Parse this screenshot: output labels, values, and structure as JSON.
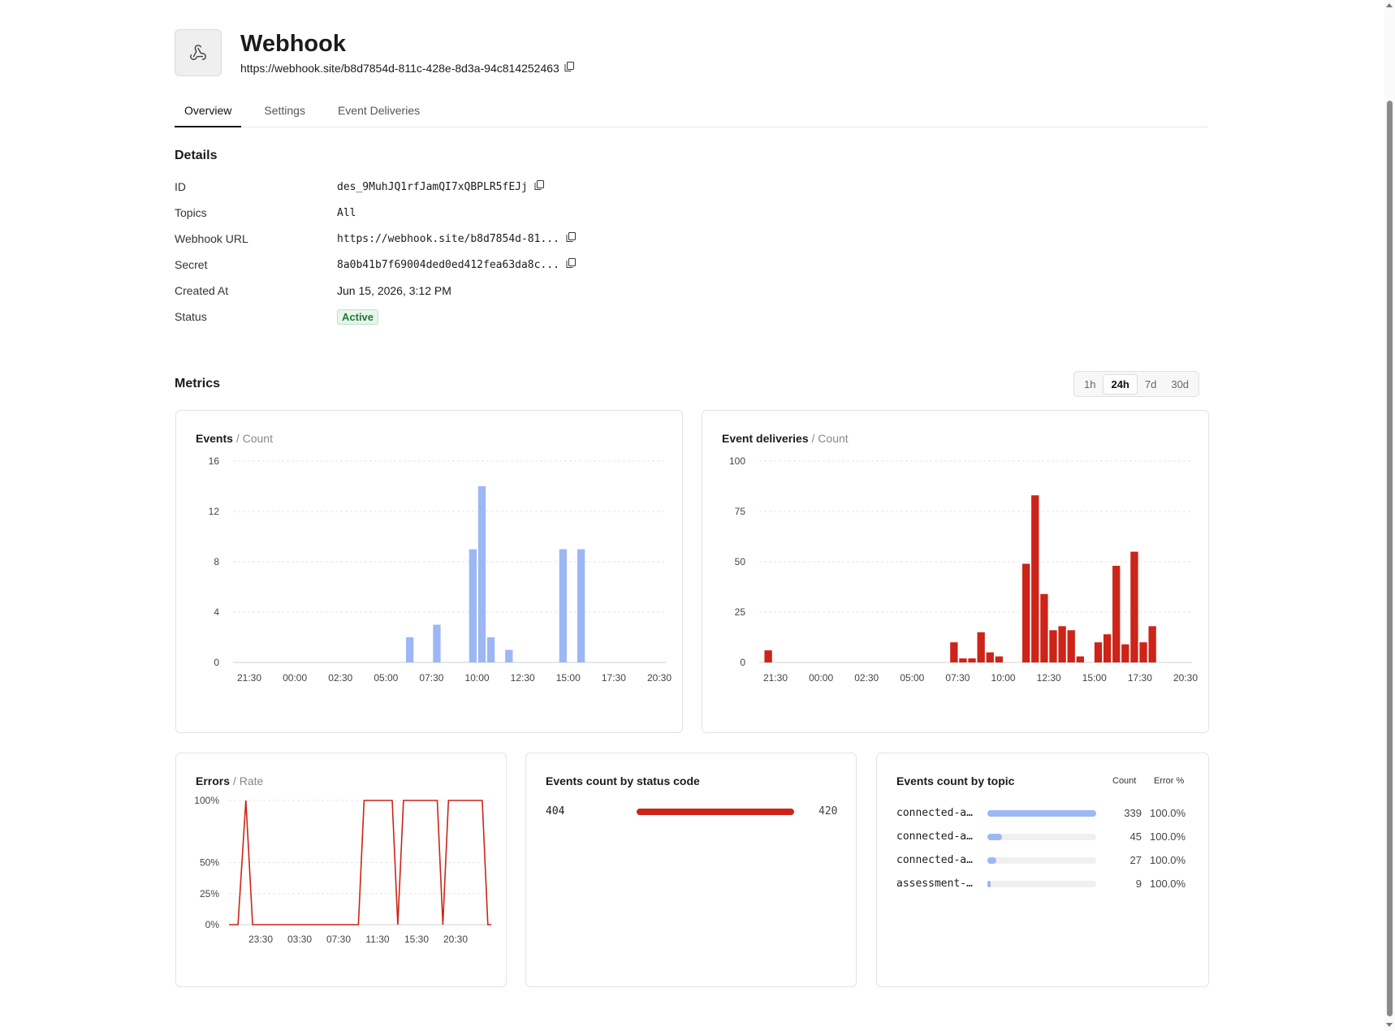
{
  "header": {
    "title": "Webhook",
    "url": "https://webhook.site/b8d7854d-811c-428e-8d3a-94c814252463"
  },
  "tabs": [
    "Overview",
    "Settings",
    "Event Deliveries"
  ],
  "details": {
    "title": "Details",
    "rows": [
      {
        "label": "ID",
        "value": "des_9MuhJQ1rfJamQI7xQBPLR5fEJj"
      },
      {
        "label": "Topics",
        "value": "All"
      },
      {
        "label": "Webhook URL",
        "value": "https://webhook.site/b8d7854d-81..."
      },
      {
        "label": "Secret",
        "value": "8a0b41b7f69004ded0ed412fea63da8c..."
      },
      {
        "label": "Created At",
        "value": "Jun 15, 2026, 3:12 PM"
      },
      {
        "label": "Status",
        "value": "Active"
      }
    ]
  },
  "metrics": {
    "title": "Metrics",
    "ranges": [
      "1h",
      "24h",
      "7d",
      "30d"
    ],
    "selected_range": "24h"
  },
  "colors": {
    "events_bar": "#9db7f5",
    "deliveries_bar": "#cc2418",
    "errors_line": "#cc2418",
    "status_ok": "#1f7a3a"
  },
  "chart_data": [
    {
      "id": "events",
      "type": "bar",
      "title": "Events",
      "subtitle": "Count",
      "x_ticks": [
        "21:30",
        "00:00",
        "02:30",
        "05:00",
        "07:30",
        "10:00",
        "12:30",
        "15:00",
        "17:30",
        "20:30"
      ],
      "y_ticks": [
        0,
        4,
        8,
        12,
        16
      ],
      "ylim": [
        0,
        16
      ],
      "bars": [
        {
          "t": 9.8,
          "value": 2
        },
        {
          "t": 11.3,
          "value": 3
        },
        {
          "t": 13.3,
          "value": 9
        },
        {
          "t": 13.8,
          "value": 14
        },
        {
          "t": 14.3,
          "value": 2
        },
        {
          "t": 15.3,
          "value": 1
        },
        {
          "t": 18.3,
          "value": 9
        },
        {
          "t": 19.3,
          "value": 9
        }
      ]
    },
    {
      "id": "deliveries",
      "type": "bar",
      "title": "Event deliveries",
      "subtitle": "Count",
      "x_ticks": [
        "21:30",
        "00:00",
        "02:30",
        "05:00",
        "07:30",
        "10:00",
        "12:30",
        "15:00",
        "17:30",
        "20:30"
      ],
      "y_ticks": [
        0,
        25,
        50,
        75,
        100
      ],
      "ylim": [
        0,
        100
      ],
      "bars": [
        {
          "t": 0.5,
          "value": 6
        },
        {
          "t": 10.8,
          "value": 10
        },
        {
          "t": 11.3,
          "value": 2
        },
        {
          "t": 11.8,
          "value": 2
        },
        {
          "t": 12.3,
          "value": 15
        },
        {
          "t": 12.8,
          "value": 5
        },
        {
          "t": 13.3,
          "value": 3
        },
        {
          "t": 14.8,
          "value": 49
        },
        {
          "t": 15.3,
          "value": 83
        },
        {
          "t": 15.8,
          "value": 34
        },
        {
          "t": 16.3,
          "value": 16
        },
        {
          "t": 16.8,
          "value": 18
        },
        {
          "t": 17.3,
          "value": 16
        },
        {
          "t": 17.8,
          "value": 3
        },
        {
          "t": 18.8,
          "value": 10
        },
        {
          "t": 19.3,
          "value": 14
        },
        {
          "t": 19.8,
          "value": 48
        },
        {
          "t": 20.3,
          "value": 9
        },
        {
          "t": 20.8,
          "value": 55
        },
        {
          "t": 21.3,
          "value": 10
        },
        {
          "t": 21.8,
          "value": 18
        }
      ]
    },
    {
      "id": "errors",
      "type": "line",
      "title": "Errors",
      "subtitle": "Rate",
      "x_ticks": [
        "23:30",
        "03:30",
        "07:30",
        "11:30",
        "15:30",
        "20:30"
      ],
      "y_ticks": [
        "0%",
        "25%",
        "50%",
        "100%"
      ],
      "ylim": [
        0,
        100
      ],
      "points": [
        [
          0,
          0
        ],
        [
          0.8,
          0
        ],
        [
          1.5,
          100
        ],
        [
          2.1,
          0
        ],
        [
          11.5,
          0
        ],
        [
          12.0,
          100
        ],
        [
          14.5,
          100
        ],
        [
          15.0,
          0
        ],
        [
          15.5,
          100
        ],
        [
          18.5,
          100
        ],
        [
          19.0,
          0
        ],
        [
          19.5,
          100
        ],
        [
          22.5,
          100
        ],
        [
          23.0,
          0
        ],
        [
          23.3,
          0
        ]
      ]
    }
  ],
  "status_codes": {
    "title": "Events count by status code",
    "rows": [
      {
        "code": "404",
        "count": 420,
        "fraction": 1.0
      }
    ]
  },
  "topics": {
    "title": "Events count by topic",
    "col_count": "Count",
    "col_error": "Error %",
    "rows": [
      {
        "name": "connected-a…",
        "count": 339,
        "error": "100.0%",
        "fraction": 1.0
      },
      {
        "name": "connected-a…",
        "count": 45,
        "error": "100.0%",
        "fraction": 0.133
      },
      {
        "name": "connected-a…",
        "count": 27,
        "error": "100.0%",
        "fraction": 0.08
      },
      {
        "name": "assessment-…",
        "count": 9,
        "error": "100.0%",
        "fraction": 0.027
      }
    ]
  }
}
